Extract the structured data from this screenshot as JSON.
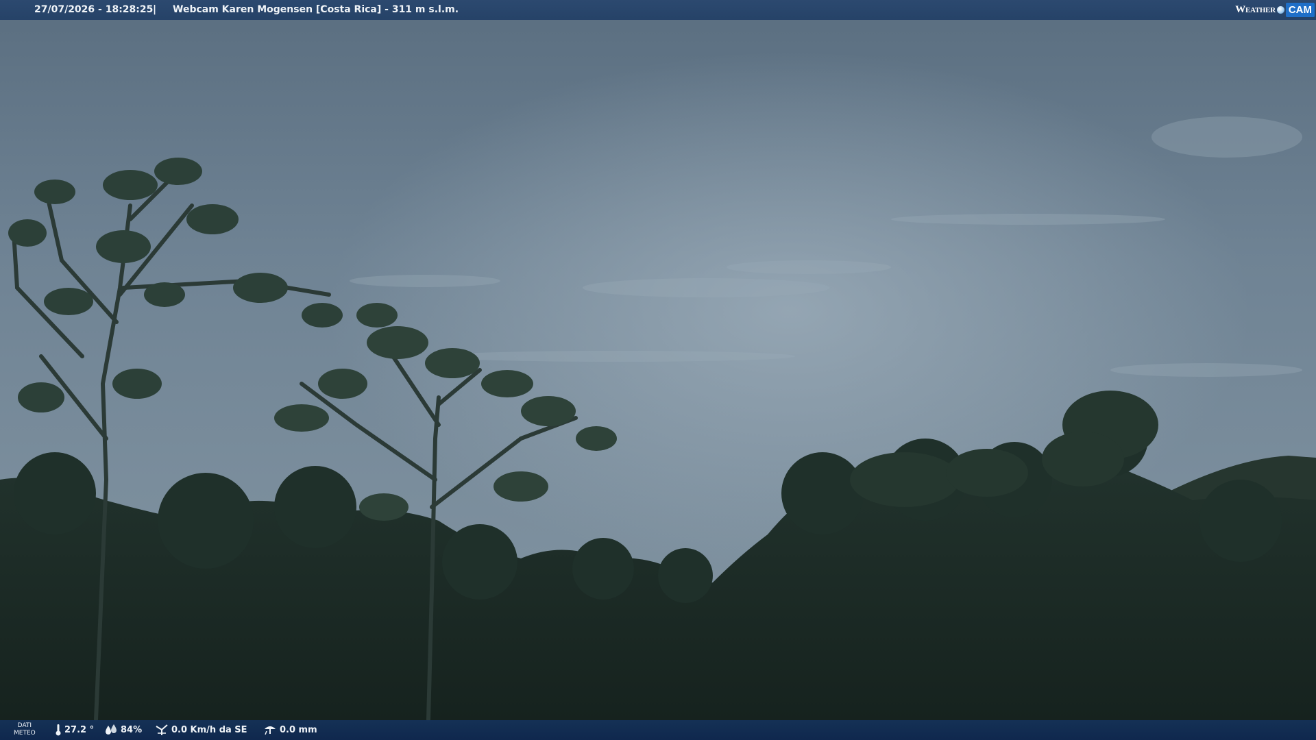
{
  "header": {
    "timestamp": "27/07/2026 - 18:28:25",
    "separator": "|",
    "title": "Webcam Karen Mogensen [Costa Rica]  - 311 m s.l.m."
  },
  "logo": {
    "word": "Weather",
    "badge": "CAM"
  },
  "footer": {
    "dati_line1": "DATI",
    "dati_line2": "METEO",
    "temperature": "27.2 °",
    "humidity": "84%",
    "wind": "0.0 Km/h da SE",
    "rain": "0.0 mm"
  },
  "icons": {
    "temperature": "thermometer-icon",
    "humidity": "droplets-icon",
    "wind": "wind-vane-icon",
    "rain": "rain-gauge-icon"
  },
  "colors": {
    "bar": "#1e3c64",
    "sky": "#6d8192",
    "forest": "#1b2a25"
  }
}
